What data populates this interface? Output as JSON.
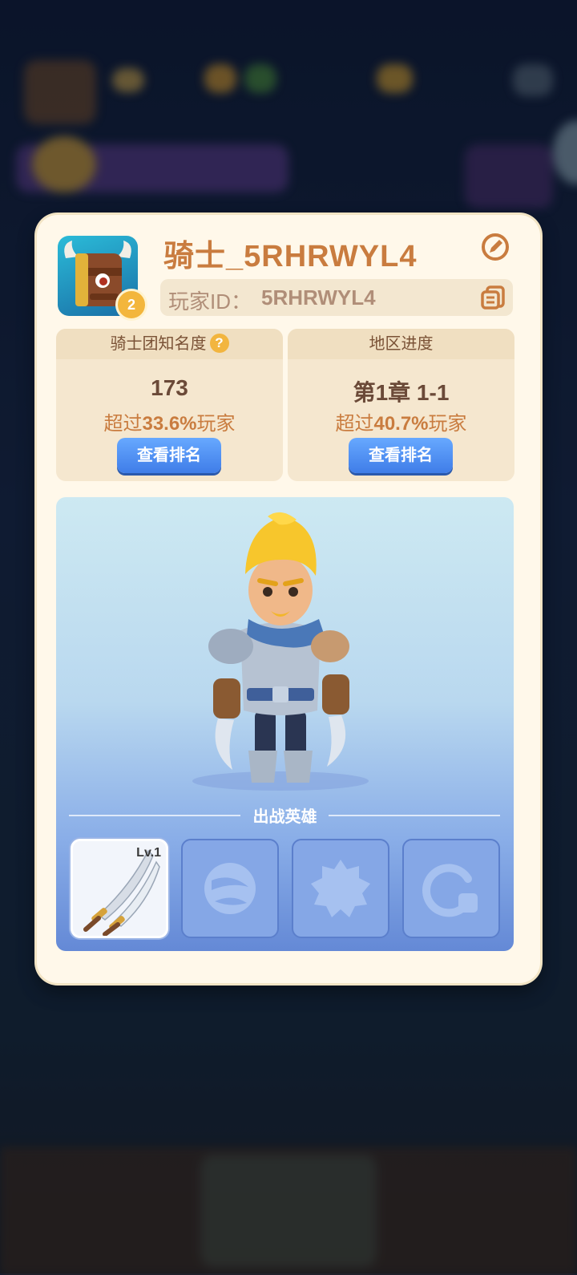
{
  "profile": {
    "username": "骑士_5RHRWYL4",
    "player_id_label": "玩家ID：",
    "player_id": "5RHRWYL4",
    "level_badge": "2"
  },
  "stats": [
    {
      "title": "骑士团知名度",
      "value": "173",
      "desc_prefix": "超过",
      "desc_percent": "33.6%",
      "desc_suffix": "玩家",
      "button": "查看排名"
    },
    {
      "title": "地区进度",
      "value": "第1章 1-1",
      "desc_prefix": "超过",
      "desc_percent": "40.7%",
      "desc_suffix": "玩家",
      "button": "查看排名"
    }
  ],
  "heroes": {
    "title": "出战英雄",
    "slots": [
      {
        "state": "equipped",
        "icon": "twin-swords-icon",
        "level": "Lv.1"
      },
      {
        "state": "locked",
        "icon": "orb-icon"
      },
      {
        "state": "locked",
        "icon": "gear-burst-icon"
      },
      {
        "state": "locked",
        "icon": "ring-icon"
      }
    ]
  },
  "colors": {
    "panel": "#fff8ea",
    "accent_text": "#c97c3f",
    "button_blue": "#4f8ef2"
  }
}
